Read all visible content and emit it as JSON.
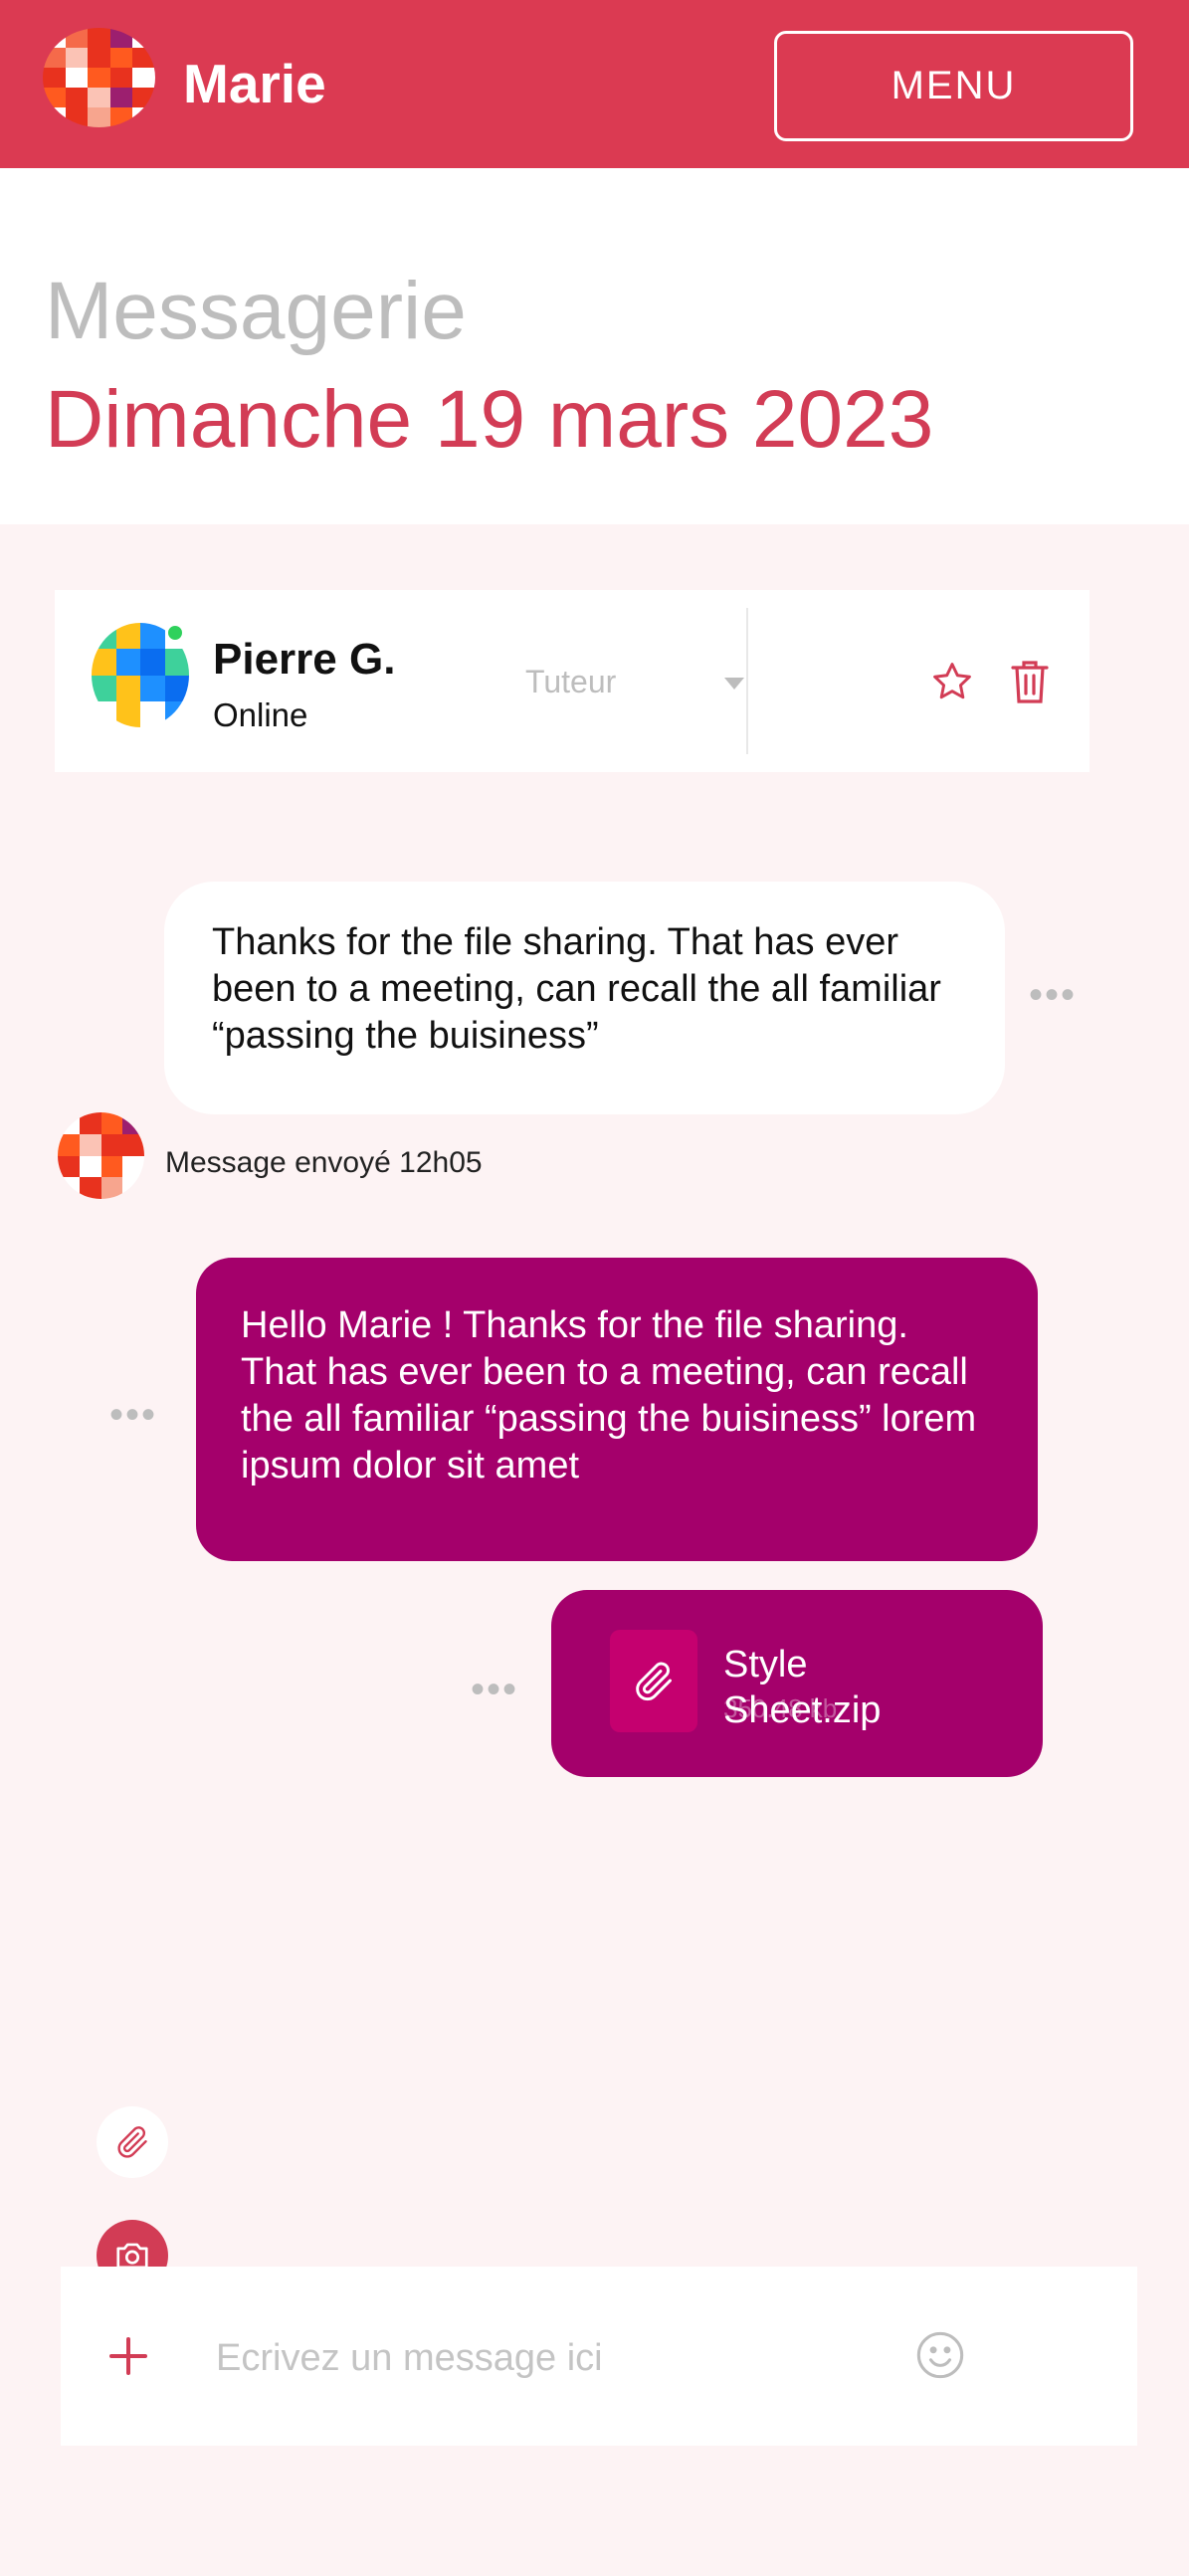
{
  "header": {
    "app_name": "Marie",
    "menu_label": "MENU",
    "colors": {
      "brand": "#db3a52"
    }
  },
  "page": {
    "title": "Messagerie",
    "date": "Dimanche 19 mars 2023"
  },
  "contact": {
    "name": "Pierre G.",
    "status": "Online",
    "role": "Tuteur",
    "icons": [
      "star-icon",
      "trash-icon"
    ]
  },
  "messages": [
    {
      "direction": "incoming",
      "text": "Thanks for the file sharing. That has ever been to a meeting, can recall the all familiar “passing the buisiness”",
      "meta": "Message envoyé 12h05"
    },
    {
      "direction": "outgoing",
      "text": "Hello Marie ! Thanks for the file sharing. That has ever been to a meeting, can recall the all familiar “passing the buisiness” lorem ipsum dolor sit amet"
    },
    {
      "direction": "outgoing",
      "type": "file",
      "file_name": "Style Sheet.zip",
      "file_size": "350.48 kb",
      "icon": "paperclip-icon"
    }
  ],
  "more_label": "•••",
  "composer": {
    "placeholder": "Ecrivez un message ici",
    "icons": [
      "plus-icon",
      "emoji-icon",
      "paperclip-icon",
      "camera-icon"
    ]
  },
  "colors": {
    "accent": "#d23c55",
    "outgoing_bubble": "#a4006b",
    "background": "#fdf3f4"
  }
}
